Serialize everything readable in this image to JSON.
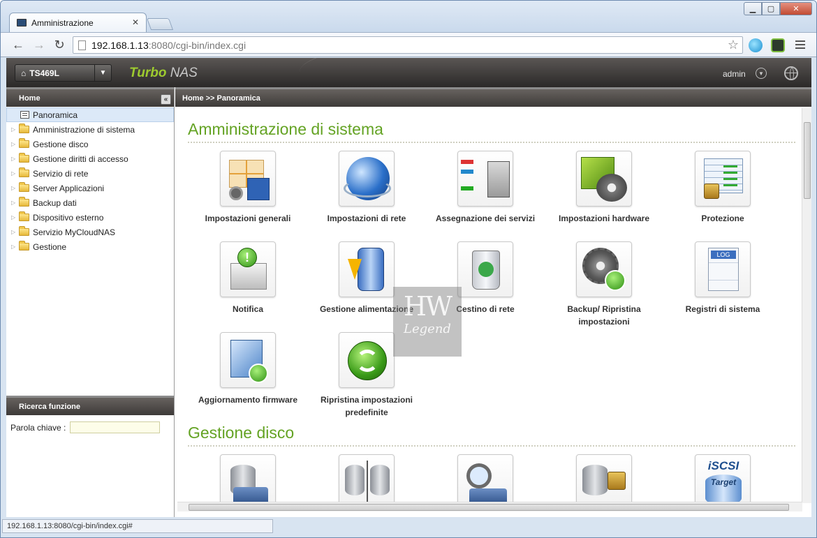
{
  "browser": {
    "tab_title": "Amministrazione",
    "url_host": "192.168.1.13",
    "url_rest": ":8080/cgi-bin/index.cgi",
    "status_url": "192.168.1.13:8080/cgi-bin/index.cgi#"
  },
  "nas": {
    "device": "TS469L",
    "brand_turbo": "Turbo",
    "brand_nas": "NAS",
    "user": "admin"
  },
  "sidebar": {
    "title": "Home",
    "items": [
      {
        "label": "Panoramica"
      },
      {
        "label": "Amministrazione di sistema"
      },
      {
        "label": "Gestione disco"
      },
      {
        "label": "Gestione diritti di accesso"
      },
      {
        "label": "Servizio di rete"
      },
      {
        "label": "Server Applicazioni"
      },
      {
        "label": "Backup dati"
      },
      {
        "label": "Dispositivo esterno"
      },
      {
        "label": "Servizio MyCloudNAS"
      },
      {
        "label": "Gestione"
      }
    ],
    "search_title": "Ricerca funzione",
    "search_label": "Parola chiave :"
  },
  "main": {
    "breadcrumb": "Home >> Panoramica",
    "section1": "Amministrazione di sistema",
    "section2": "Gestione disco",
    "tiles": [
      {
        "label": "Impostazioni generali"
      },
      {
        "label": "Impostazioni di rete"
      },
      {
        "label": "Assegnazione dei servizi"
      },
      {
        "label": "Impostazioni hardware"
      },
      {
        "label": "Protezione"
      },
      {
        "label": "Notifica"
      },
      {
        "label": "Gestione alimentazione"
      },
      {
        "label": "Cestino di rete"
      },
      {
        "label": "Backup/ Ripristina impostazioni"
      },
      {
        "label": "Registri di sistema"
      },
      {
        "label": "Aggiornamento firmware"
      },
      {
        "label": "Ripristina impostazioni predefinite"
      }
    ],
    "iscsi_text": "iSCSI",
    "target_text": "Target"
  },
  "watermark": {
    "big": "HW",
    "small": "Legend"
  },
  "colors": {
    "accent_green": "#64a324",
    "header_dark": "#3d3a38",
    "brand_green": "#9ecb2f"
  }
}
